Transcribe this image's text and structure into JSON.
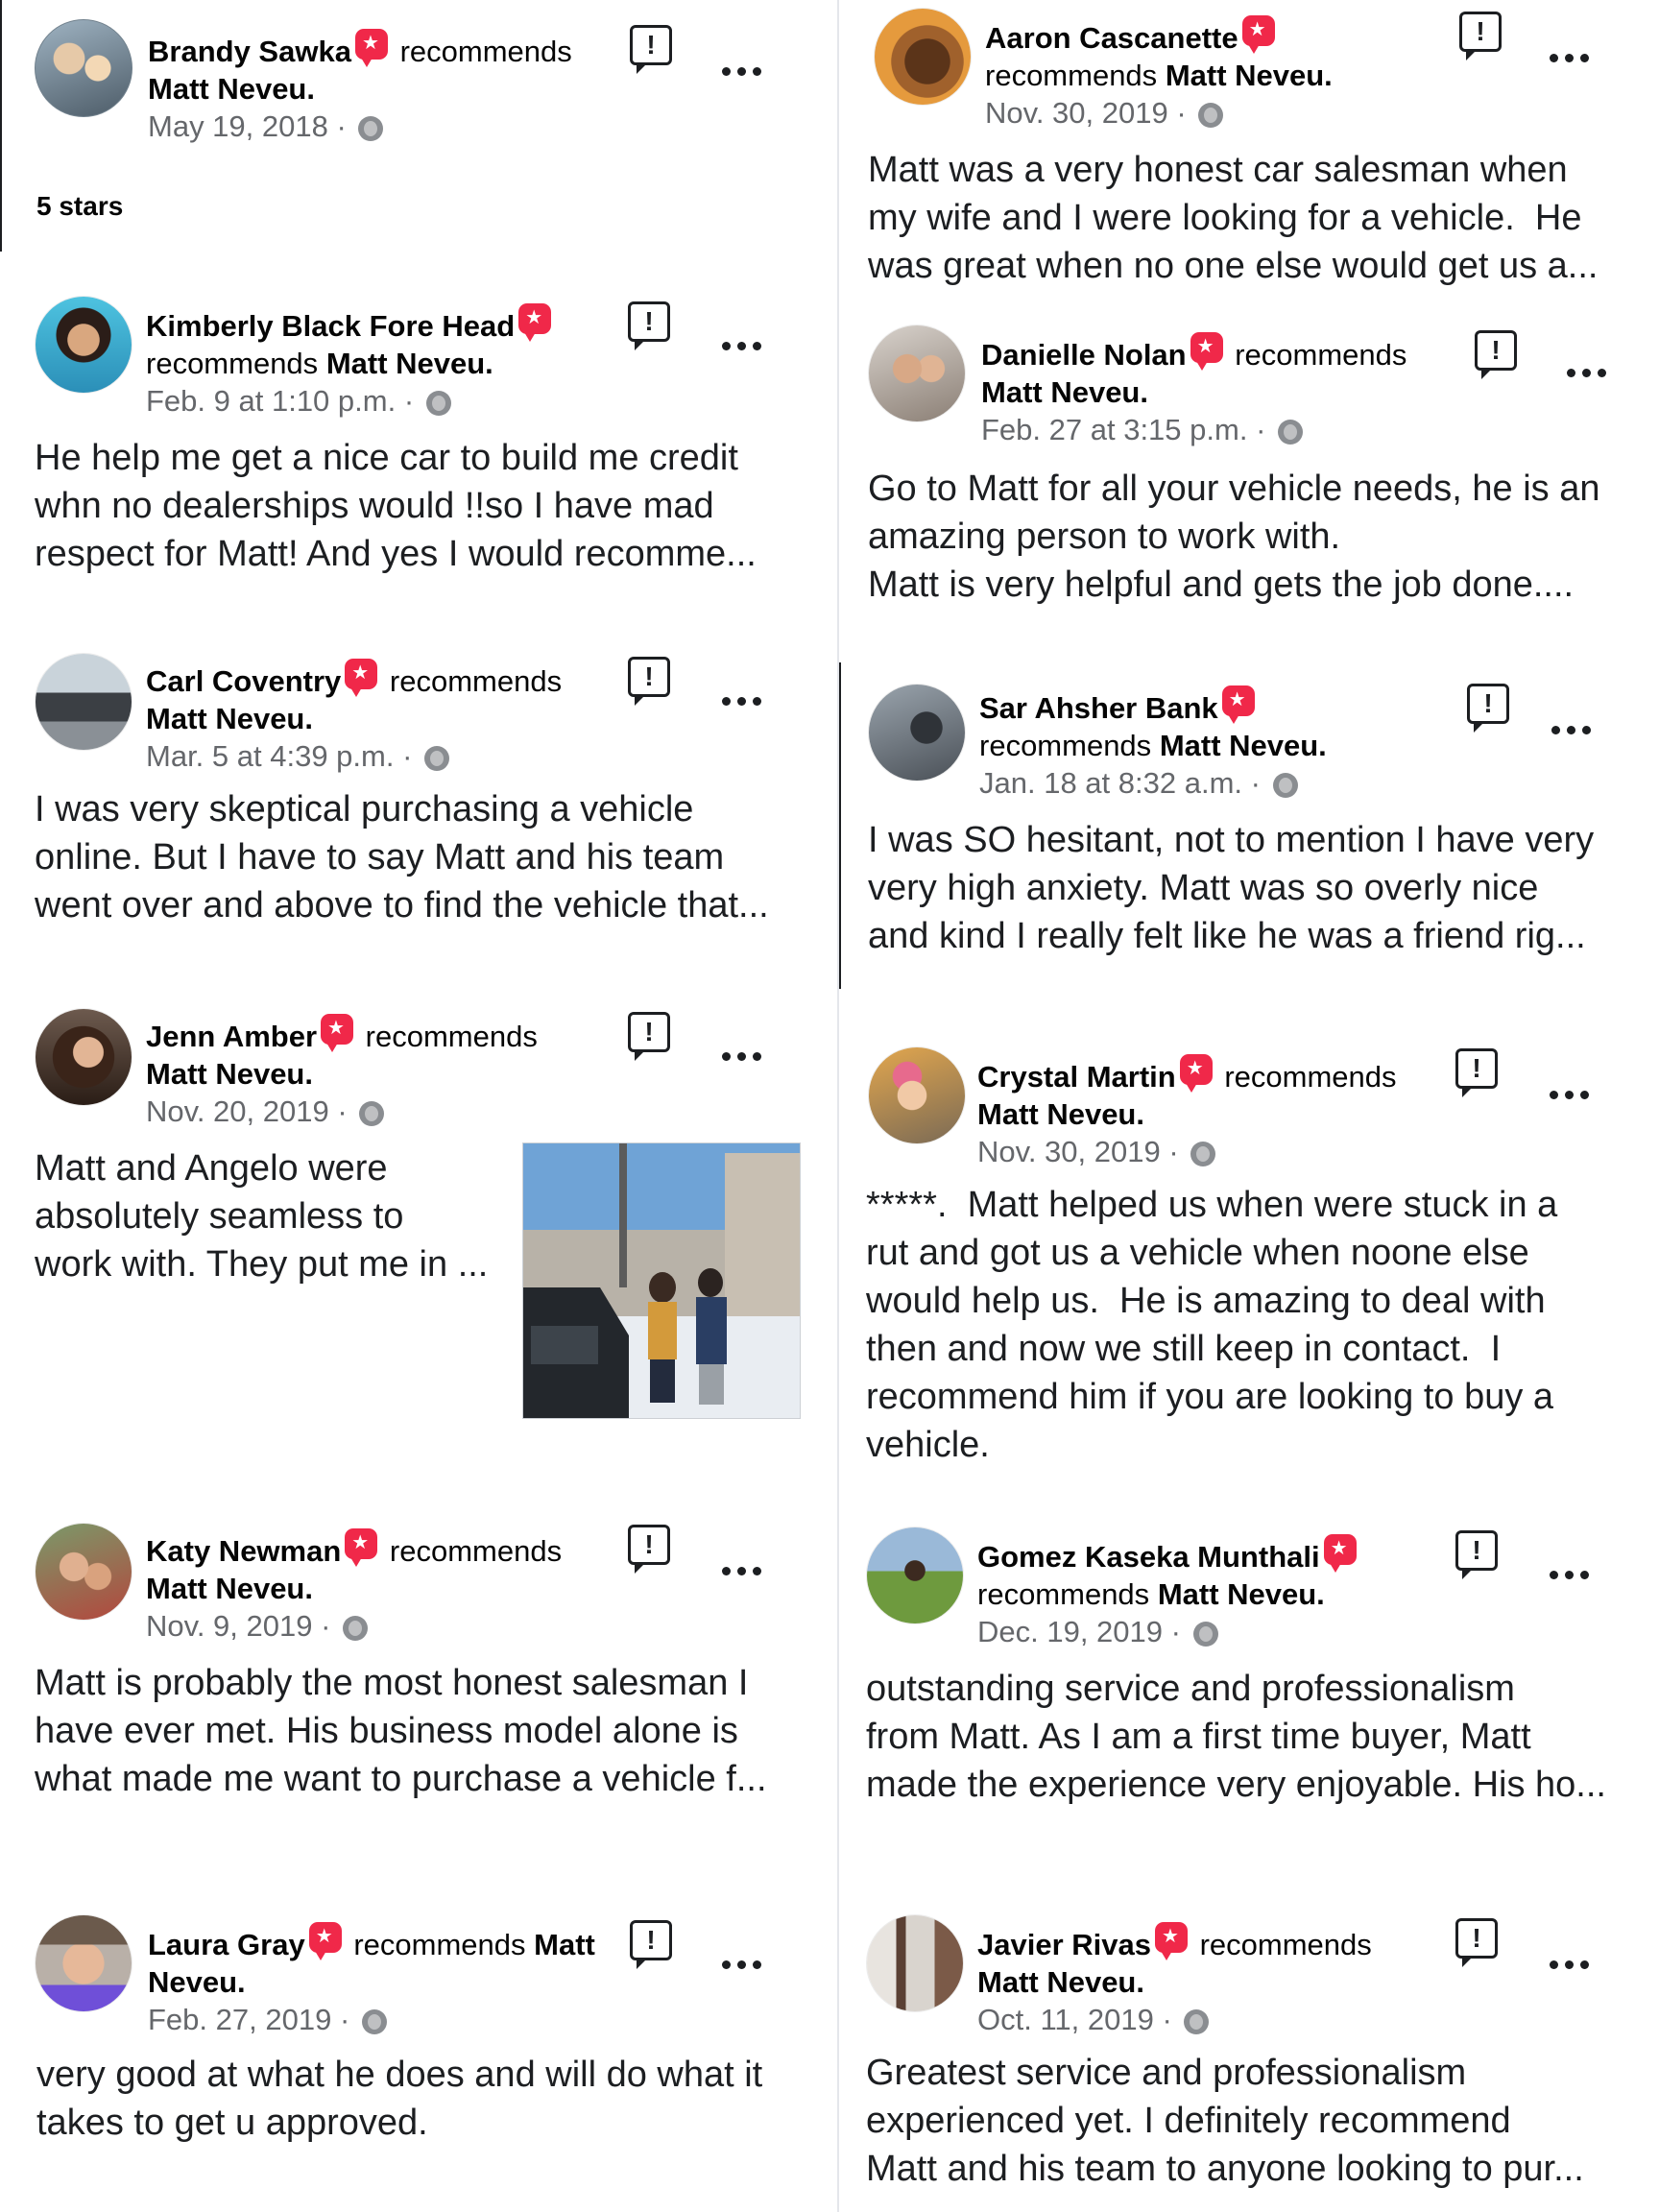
{
  "recommended_page": "Matt Neveu",
  "recommends_word": "recommends",
  "icons": {
    "recommend_badge": "recommend-star-icon",
    "report": "report-icon",
    "more": "more-options-icon",
    "privacy": "globe-icon"
  },
  "colors": {
    "badge": "#f02849",
    "meta": "#65676b",
    "text": "#1c1e21"
  },
  "reviews": [
    {
      "name": "Brandy Sawka",
      "page": "Matt Neveu.",
      "date": "May 19, 2018",
      "text": "",
      "rating": "5 stars"
    },
    {
      "name": "Kimberly Black Fore Head",
      "page": "Matt Neveu.",
      "date": "Feb. 9 at 1:10 p.m.",
      "text": "He help me get a nice car to build me credit\nwhn no dealerships would !!so I have mad\nrespect for Matt! And yes I would recomme..."
    },
    {
      "name": "Carl Coventry",
      "page": "Matt Neveu.",
      "date": "Mar. 5 at 4:39 p.m.",
      "text": "I was very skeptical purchasing a vehicle\nonline. But I have to say Matt and his team\nwent over and above to find the vehicle that..."
    },
    {
      "name": "Jenn Amber",
      "page": "Matt Neveu.",
      "date": "Nov. 20, 2019",
      "text": "Matt and Angelo were\nabsolutely seamless to\nwork with. They put me in ..."
    },
    {
      "name": "Katy Newman",
      "page": "Matt Neveu.",
      "date": "Nov. 9, 2019",
      "text": "Matt is probably the most honest salesman I\nhave ever met. His business model alone is\nwhat made me want to purchase a vehicle f..."
    },
    {
      "name": "Laura Gray",
      "page": "Matt\nNeveu.",
      "date": "Feb. 27, 2019",
      "text": "very good at what he does and will do what it\ntakes to get u approved."
    },
    {
      "name": "Aaron Cascanette",
      "page": "Matt Neveu.",
      "date": "Nov. 30, 2019",
      "text": "Matt was a very honest car salesman when\nmy wife and I were looking for a vehicle.  He\nwas great when no one else would get us a..."
    },
    {
      "name": "Danielle Nolan",
      "page": "Matt Neveu.",
      "date": "Feb. 27 at 3:15 p.m.",
      "text": "Go to Matt for all your vehicle needs, he is an\namazing person to work with.\nMatt is very helpful and gets the job done...."
    },
    {
      "name": "Sar Ahsher Bank",
      "page": "Matt Neveu.",
      "date": "Jan. 18 at 8:32 a.m.",
      "text": "I was SO hesitant, not to mention I have very\nvery high anxiety. Matt was so overly nice\nand kind I really felt like he was a friend rig..."
    },
    {
      "name": "Crystal Martin",
      "page": "Matt Neveu.",
      "date": "Nov. 30, 2019",
      "text": "*****.  Matt helped us when were stuck in a\nrut and got us a vehicle when noone else\nwould help us.  He is amazing to deal with\nthen and now we still keep in contact.  I\nrecommend him if you are looking to buy a\nvehicle."
    },
    {
      "name": "Gomez Kaseka Munthali",
      "page": "Matt Neveu.",
      "date": "Dec. 19, 2019",
      "text": "outstanding service and professionalism\nfrom Matt. As I am a first time buyer, Matt\nmade the experience very enjoyable. His ho..."
    },
    {
      "name": "Javier Rivas",
      "page": "Matt Neveu.",
      "date": "Oct. 11, 2019",
      "text": "Greatest service and professionalism\nexperienced yet. I definitely recommend\nMatt and his team to anyone looking to pur..."
    }
  ]
}
